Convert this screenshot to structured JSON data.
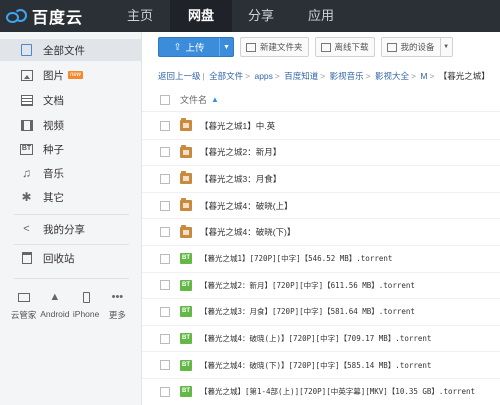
{
  "app": {
    "brand": "百度云",
    "nav": [
      "主页",
      "网盘",
      "分享",
      "应用"
    ],
    "active_nav": "网盘"
  },
  "sidebar": {
    "items": [
      {
        "label": "全部文件",
        "icon": "files-icon",
        "active": true
      },
      {
        "label": "图片",
        "icon": "image-icon",
        "badge": "new"
      },
      {
        "label": "文档",
        "icon": "document-icon"
      },
      {
        "label": "视频",
        "icon": "video-icon"
      },
      {
        "label": "种子",
        "icon": "bt-icon",
        "icon_text": "BT"
      },
      {
        "label": "音乐",
        "icon": "music-icon"
      },
      {
        "label": "其它",
        "icon": "other-icon"
      },
      {
        "label": "我的分享",
        "icon": "share-icon"
      },
      {
        "label": "回收站",
        "icon": "trash-icon"
      }
    ],
    "devices": [
      {
        "label": "云管家",
        "icon": "monitor-icon"
      },
      {
        "label": "Android",
        "icon": "android-icon"
      },
      {
        "label": "iPhone",
        "icon": "iphone-icon"
      },
      {
        "label": "更多",
        "icon": "more-icon"
      }
    ]
  },
  "toolbar": {
    "upload": "上传",
    "new_folder": "新建文件夹",
    "offline_download": "离线下载",
    "my_devices": "我的设备"
  },
  "breadcrumb": {
    "back": "返回上一级",
    "items": [
      "全部文件",
      "apps",
      "百度知道",
      "影视音乐",
      "影视大全",
      "M"
    ],
    "current": "【暮光之城】"
  },
  "list": {
    "header": "文件名",
    "files": [
      {
        "name": "【暮光之城1】中.英",
        "type": "folder"
      },
      {
        "name": "【暮光之城2：新月】",
        "type": "folder"
      },
      {
        "name": "【暮光之城3：月食】",
        "type": "folder"
      },
      {
        "name": "【暮光之城4：破晓(上】",
        "type": "folder"
      },
      {
        "name": "【暮光之城4：破晓(下)】",
        "type": "folder"
      },
      {
        "name": "【暮光之城1】[720P][中字]【546.52 MB】.torrent",
        "type": "bt"
      },
      {
        "name": "【暮光之城2：新月】[720P][中字]【611.56 MB】.torrent",
        "type": "bt"
      },
      {
        "name": "【暮光之城3：月食】[720P][中字]【581.64 MB】.torrent",
        "type": "bt"
      },
      {
        "name": "【暮光之城4：破晓(上)】[720P][中字]【709.17 MB】.torrent",
        "type": "bt"
      },
      {
        "name": "【暮光之城4：破晓(下)】[720P][中字]【585.14 MB】.torrent",
        "type": "bt"
      },
      {
        "name": "【暮光之城】[第1-4部(上)][720P][中英字幕][MKV]【10.35 GB】.torrent",
        "type": "bt"
      }
    ],
    "file_icon_text": "BT"
  },
  "colors": {
    "topbar": "#2b2f36",
    "accent": "#3b8cdb",
    "folder": "#c9893f",
    "bt": "#65b845"
  }
}
